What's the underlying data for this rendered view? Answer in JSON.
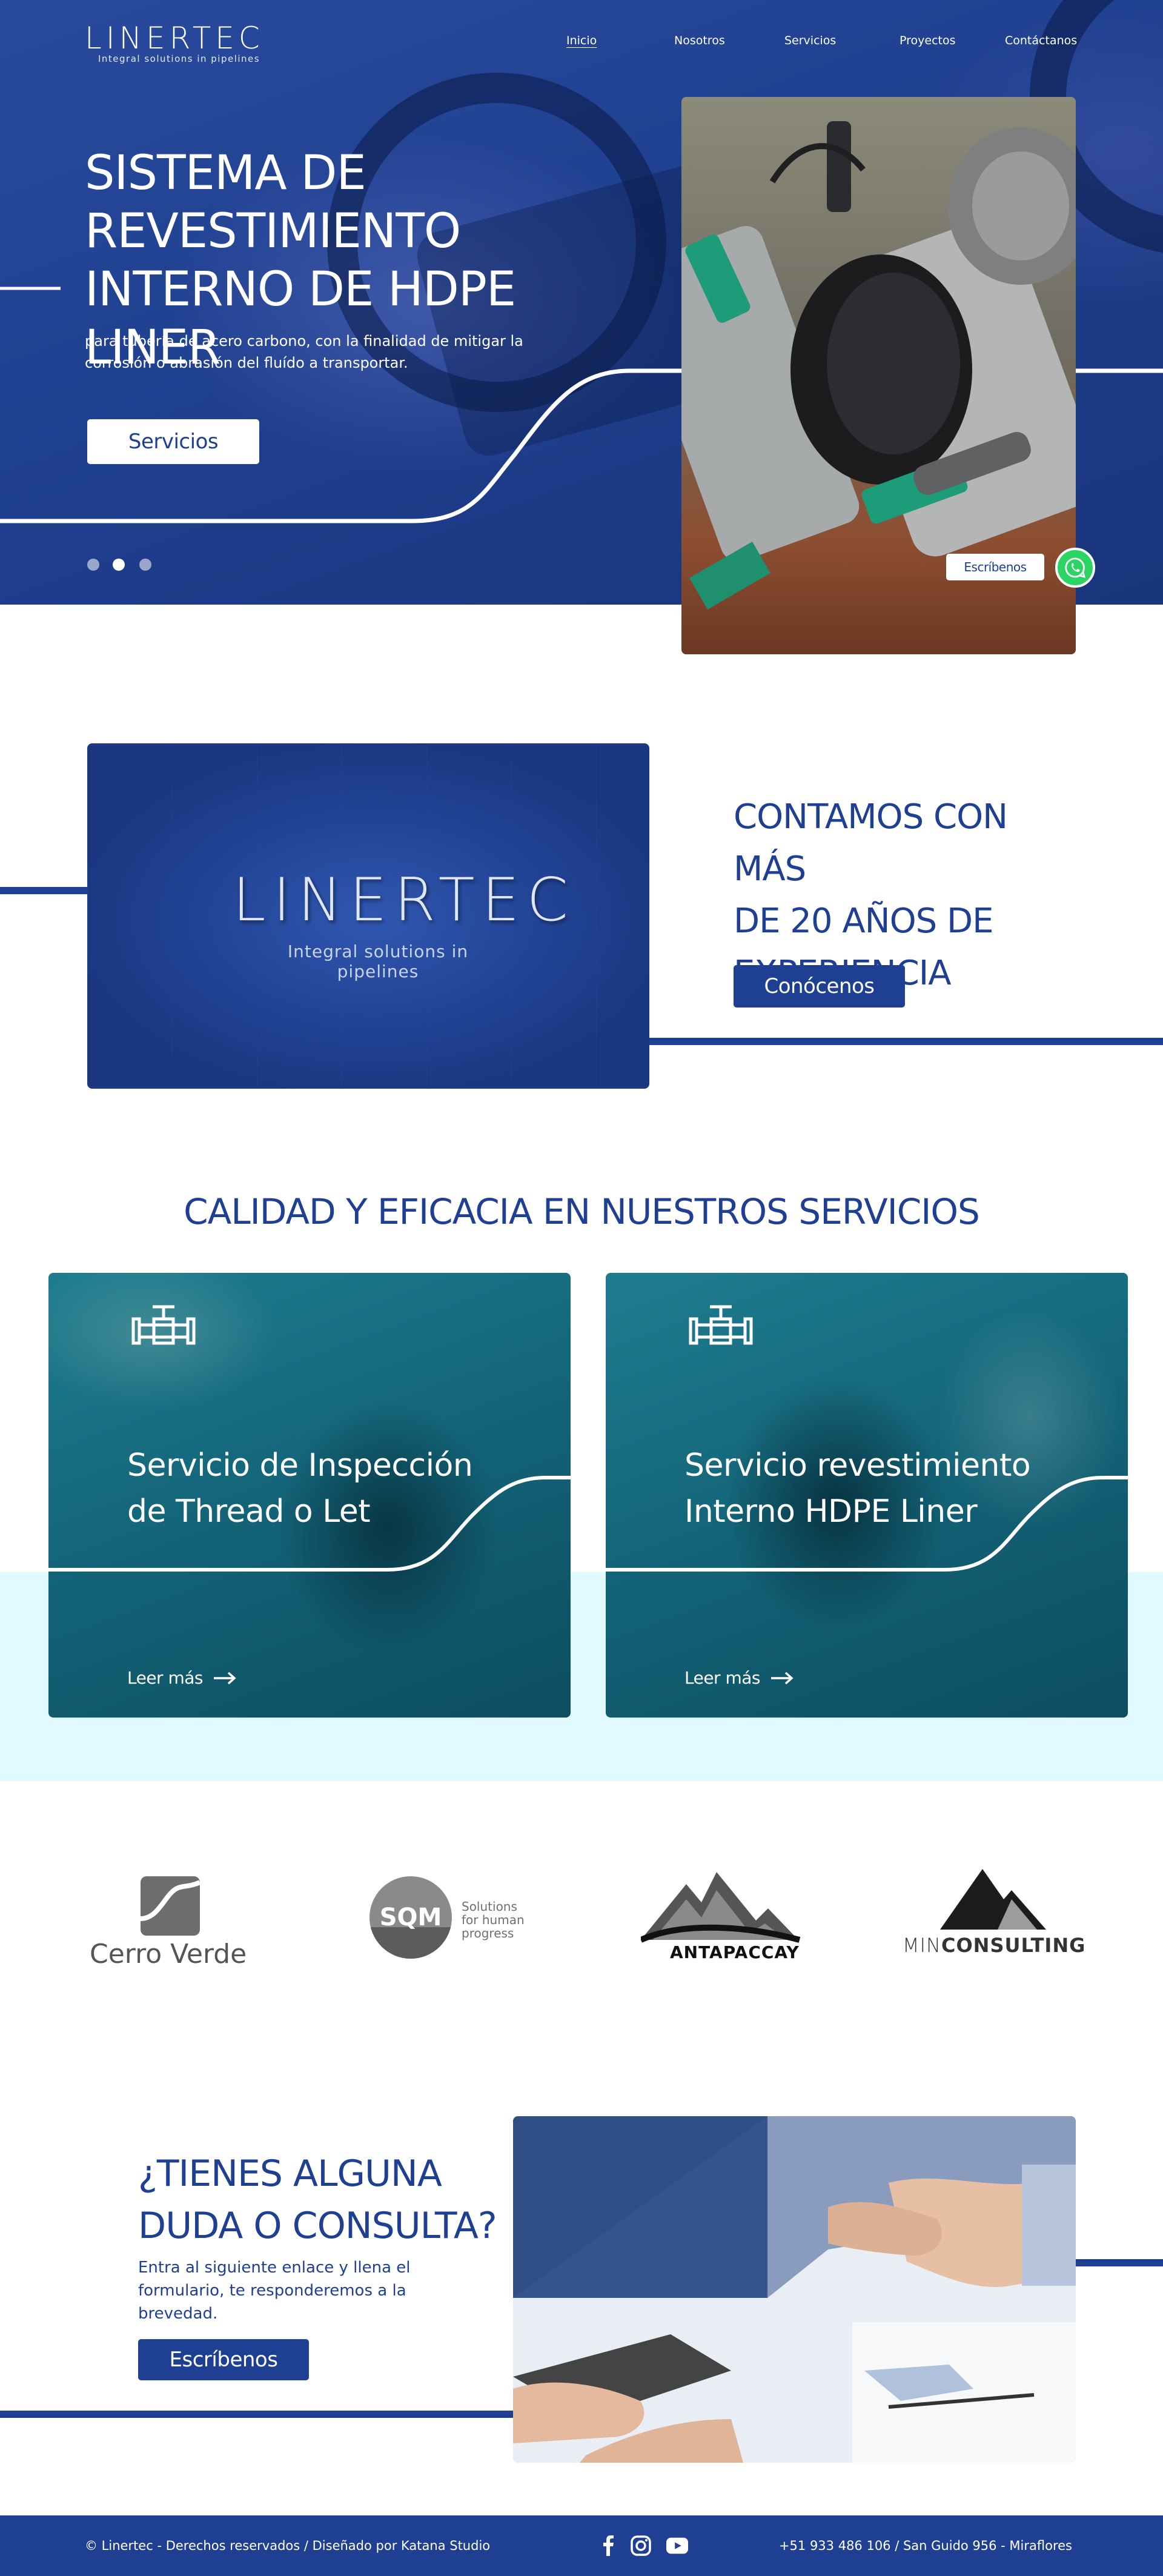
{
  "header": {
    "logo": "LINERTEC",
    "tagline": "Integral solutions in pipelines",
    "nav": [
      "Inicio",
      "Nosotros",
      "Servicios",
      "Proyectos",
      "Contáctanos"
    ]
  },
  "hero": {
    "title_lines": [
      "SISTEMA DE",
      "REVESTIMIENTO",
      "INTERNO DE HDPE LINER"
    ],
    "description": "para tubería de acero carbono, con la finalidad de mitigar la corrosión o abrasión del fluído a transportar.",
    "button": "Servicios",
    "slides": 3,
    "active_slide": 1
  },
  "whatsapp": {
    "label": "Escríbenos",
    "icon": "whatsapp-icon"
  },
  "experience": {
    "image_logo": "LINERTEC",
    "image_tagline": "Integral solutions in pipelines",
    "title_lines": [
      "CONTAMOS CON MÁS",
      "DE 20 AÑOS DE",
      "EXPERIENCIA"
    ],
    "button": "Conócenos"
  },
  "services": {
    "heading": "CALIDAD Y EFICACIA EN NUESTROS SERVICIOS",
    "cards": [
      {
        "title_lines": [
          "Servicio de Inspección",
          "de Thread o Let"
        ],
        "link": "Leer más",
        "icon": "pipe-valve-icon"
      },
      {
        "title_lines": [
          "Servicio revestimiento",
          "Interno HDPE Liner"
        ],
        "link": "Leer más",
        "icon": "pipe-valve-icon"
      }
    ]
  },
  "clients": {
    "cerro_verde": "Cerro Verde",
    "sqm": {
      "logo": "SQM",
      "text_lines": [
        "Solutions",
        "for human",
        "progress"
      ]
    },
    "antapaccay": "ANTAPACCAY",
    "minconsulting": {
      "light": "MIN",
      "bold": "CONSULTING"
    }
  },
  "contact": {
    "title_lines": [
      "¿TIENES ALGUNA",
      "DUDA O CONSULTA?"
    ],
    "description": "Entra al siguiente enlace y llena el formulario, te responderemos a la brevedad.",
    "button": "Escríbenos"
  },
  "footer": {
    "copyright": "© Linertec - Derechos reservados / Diseñado por Katana Studio",
    "contact": "+51 933 486 106 / San Guido 956 - Miraflores",
    "socials": [
      "facebook-icon",
      "instagram-icon",
      "youtube-icon"
    ]
  },
  "colors": {
    "brand_blue": "#1f3f93",
    "teal": "#136377",
    "light_cyan": "#e0faff",
    "whatsapp": "#2bd463"
  }
}
